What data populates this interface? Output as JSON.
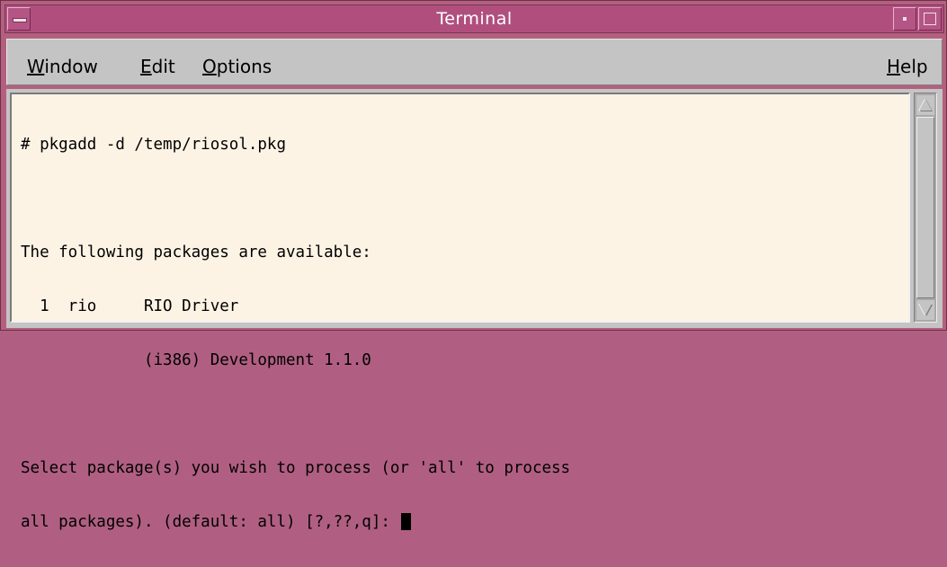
{
  "window": {
    "title": "Terminal"
  },
  "menubar": {
    "items": [
      {
        "label_pre": "",
        "mnemonic": "W",
        "label_post": "indow"
      },
      {
        "label_pre": "",
        "mnemonic": "E",
        "label_post": "dit"
      },
      {
        "label_pre": "",
        "mnemonic": "O",
        "label_post": "ptions"
      }
    ],
    "help": {
      "label_pre": "",
      "mnemonic": "H",
      "label_post": "elp"
    }
  },
  "terminal": {
    "lines": [
      "# pkgadd -d /temp/riosol.pkg",
      "",
      "The following packages are available:",
      "  1  rio     RIO Driver",
      "             (i386) Development 1.1.0",
      "",
      "Select package(s) you wish to process (or 'all' to process",
      "all packages). (default: all) [?,??,q]: "
    ]
  },
  "icons": {
    "window_menu": "window-menu-icon",
    "minimize": "minimize-icon",
    "maximize": "maximize-icon",
    "scroll_up": "scroll-up-arrow-icon",
    "scroll_down": "scroll-down-arrow-icon"
  },
  "colors": {
    "titlebar": "#b04f7e",
    "terminal_bg": "#fdf3e5",
    "chrome": "#c4c4c4"
  }
}
